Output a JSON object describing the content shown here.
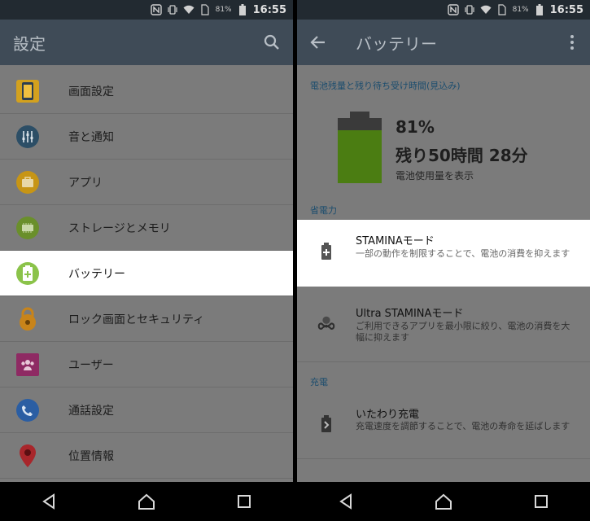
{
  "status_bar": {
    "battery_percent": "81%",
    "time": "16:55"
  },
  "left": {
    "app_title": "設定",
    "items": [
      {
        "label": "画面設定",
        "icon": "display-icon",
        "icon_bg": "#5a6f86"
      },
      {
        "label": "音と通知",
        "icon": "sound-icon",
        "icon_bg": "#2c4e66"
      },
      {
        "label": "アプリ",
        "icon": "apps-icon",
        "icon_bg": "#c79515"
      },
      {
        "label": "ストレージとメモリ",
        "icon": "storage-icon",
        "icon_bg": "#6a8f2b"
      },
      {
        "label": "バッテリー",
        "icon": "battery-icon",
        "icon_bg": "#8bc34a"
      },
      {
        "label": "ロック画面とセキュリティ",
        "icon": "lock-icon",
        "icon_bg": "#c8841a"
      },
      {
        "label": "ユーザー",
        "icon": "users-icon",
        "icon_bg": "#8e2a63"
      },
      {
        "label": "通話設定",
        "icon": "phone-icon",
        "icon_bg": "#2b5ea3"
      },
      {
        "label": "位置情報",
        "icon": "location-icon",
        "icon_bg": "#a8262b"
      }
    ]
  },
  "right": {
    "app_title": "バッテリー",
    "battery_section_header": "電池残量と残り待ち受け時間(見込み)",
    "battery_percent": "81%",
    "battery_level": 0.81,
    "remaining_time": "残り50時間 28分",
    "usage_link": "電池使用量を表示",
    "power_saving_header": "省電力",
    "stamina": {
      "title": "STAMINAモード",
      "subtitle": "一部の動作を制限することで、電池の消費を抑えます"
    },
    "ultra_stamina": {
      "title": "Ultra STAMINAモード",
      "subtitle": "ご利用できるアプリを最小限に絞り、電池の消費を大幅に抑えます"
    },
    "charging_header": "充電",
    "care_charging": {
      "title": "いたわり充電",
      "subtitle": "充電速度を調節することで、電池の寿命を延ばします"
    }
  },
  "colors": {
    "app_bar": "#3f4b57",
    "status_bar": "#222a31",
    "dim_background": "#7b7b7b",
    "highlight": "#ffffff",
    "battery_fill": "#4b7d12",
    "section_header": "#1c4d6e"
  }
}
